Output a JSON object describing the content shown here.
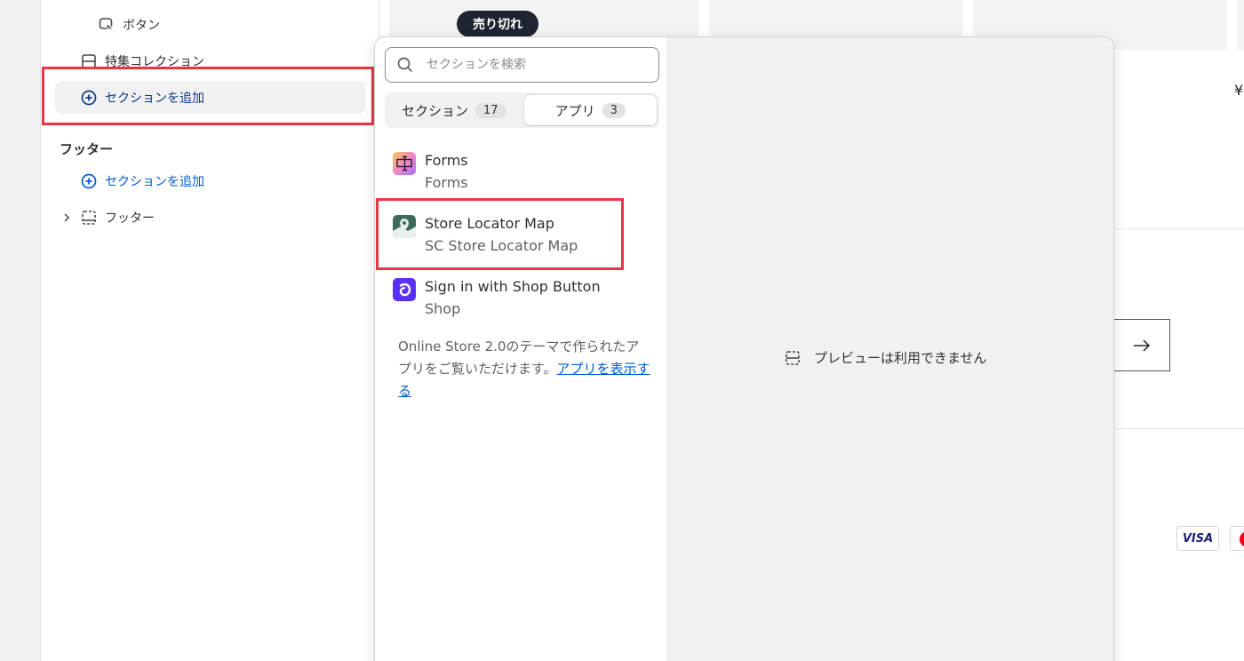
{
  "sidebar": {
    "button_item": "ボタン",
    "featured_collection": "特集コレクション",
    "add_section_highlighted": "セクションを追加",
    "footer_heading": "フッター",
    "footer_add_section": "セクションを追加",
    "footer_item": "フッター"
  },
  "canvas": {
    "sold_out_badge": "売り切れ",
    "price_fragment": "¥",
    "visa_label": "VISA"
  },
  "picker": {
    "search_placeholder": "セクションを検索",
    "tabs": [
      {
        "label": "セクション",
        "count": "17",
        "active": false
      },
      {
        "label": "アプリ",
        "count": "3",
        "active": true
      }
    ],
    "apps": [
      {
        "name": "Forms",
        "vendor": "Forms",
        "icon": "forms-app-icon"
      },
      {
        "name": "Store Locator Map",
        "vendor": "SC Store Locator Map",
        "icon": "map-pin-app-icon"
      },
      {
        "name": "Sign in with Shop Button",
        "vendor": "Shop",
        "icon": "shop-app-icon"
      }
    ],
    "note_text": "Online Store 2.0のテーマで作られたアプリをご覧いただけます。",
    "note_link": "アプリを表示する",
    "preview_unavailable": "プレビューは利用できません"
  },
  "colors": {
    "highlight": "#ec3445",
    "link_blue": "#005bd3",
    "badge_dark": "#1e2432"
  }
}
